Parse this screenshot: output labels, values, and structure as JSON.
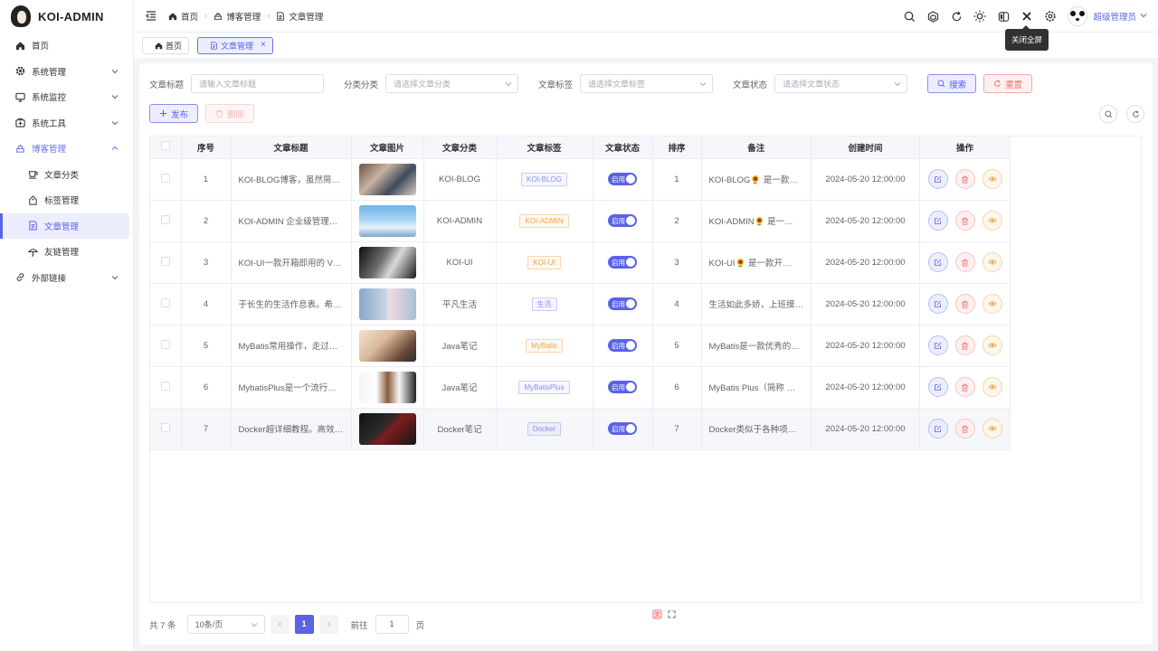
{
  "app": {
    "title": "KOI-ADMIN"
  },
  "sidebar": {
    "items": [
      {
        "label": "首页",
        "icon": "home-icon"
      },
      {
        "label": "系统管理",
        "icon": "gear-icon"
      },
      {
        "label": "系统监控",
        "icon": "monitor-icon"
      },
      {
        "label": "系统工具",
        "icon": "toolbox-icon"
      },
      {
        "label": "博客管理",
        "icon": "blog-icon"
      },
      {
        "label": "文章分类",
        "icon": "cup-icon"
      },
      {
        "label": "标签管理",
        "icon": "tag-icon"
      },
      {
        "label": "文章管理",
        "icon": "document-icon"
      },
      {
        "label": "友链管理",
        "icon": "umbrella-icon"
      },
      {
        "label": "外部链接",
        "icon": "link-icon"
      }
    ]
  },
  "header": {
    "breadcrumb": [
      "首页",
      "博客管理",
      "文章管理"
    ],
    "username": "超级管理员",
    "tooltip": "关闭全屏"
  },
  "tabs": [
    {
      "label": "首页",
      "icon": "home-icon"
    },
    {
      "label": "文章管理",
      "icon": "document-icon",
      "active": true,
      "close": "×"
    }
  ],
  "search": {
    "title_label": "文章标题",
    "title_placeholder": "请输入文章标题",
    "category_label": "分类分类",
    "category_placeholder": "请选择文章分类",
    "tag_label": "文章标签",
    "tag_placeholder": "请选择文章标签",
    "status_label": "文章状态",
    "status_placeholder": "请选择文章状态",
    "search_button": "搜索",
    "reset_button": "重置"
  },
  "actions": {
    "publish": "发布",
    "delete": "删除"
  },
  "table": {
    "columns": [
      "",
      "序号",
      "文章标题",
      "文章图片",
      "文章分类",
      "文章标签",
      "文章状态",
      "排序",
      "备注",
      "创建时间",
      "操作"
    ],
    "status_label": "启用",
    "rows": [
      {
        "index": "1",
        "title": "KOI-BLOG博客，虽然简…",
        "category": "KOI-BLOG",
        "tag": "KOI-BLOG",
        "tag_color": "#8a90ee",
        "sort": "1",
        "remark": "KOI-BLOG🌻 是一款…",
        "created": "2024-05-20 12:00:00"
      },
      {
        "index": "2",
        "title": "KOI-ADMIN 企业级管理…",
        "category": "KOI-ADMIN",
        "tag": "KOI-ADMIN",
        "tag_color": "#f0a34d",
        "sort": "2",
        "remark": "KOI-ADMIN🌻 是一…",
        "created": "2024-05-20 12:00:00"
      },
      {
        "index": "3",
        "title": "KOI-UI一款开箱即用的 V…",
        "category": "KOI-UI",
        "tag": "KOI-UI",
        "tag_color": "#f0a34d",
        "sort": "3",
        "remark": "KOI-UI🌻 是一款开…",
        "created": "2024-05-20 12:00:00"
      },
      {
        "index": "4",
        "title": "于长生的生活作息表。希…",
        "category": "平凡生活",
        "tag": "生活",
        "tag_color": "#8a90ee",
        "sort": "4",
        "remark": "生活如此多娇，上班摸…",
        "created": "2024-05-20 12:00:00"
      },
      {
        "index": "5",
        "title": "MyBatis常用操作，走过…",
        "category": "Java笔记",
        "tag": "MyBatis",
        "tag_color": "#f0a34d",
        "sort": "5",
        "remark": "MyBatis是一款优秀的…",
        "created": "2024-05-20 12:00:00"
      },
      {
        "index": "6",
        "title": "MybatisPlus是一个流行…",
        "category": "Java笔记",
        "tag": "MyBatisPlus",
        "tag_color": "#8a90ee",
        "sort": "6",
        "remark": "MyBatis Plus（简称 …",
        "created": "2024-05-20 12:00:00"
      },
      {
        "index": "7",
        "title": "Docker超详细教程。高效…",
        "category": "Docker笔记",
        "tag": "Docker",
        "tag_color": "#8a90ee",
        "sort": "7",
        "remark": "Docker类似于各种项…",
        "created": "2024-05-20 12:00:00"
      }
    ]
  },
  "pagination": {
    "total_text": "共 7 条",
    "page_size": "10条/页",
    "current_page": "1",
    "goto_label": "前往",
    "goto_value": "1",
    "goto_unit": "页"
  },
  "colors": {
    "accent": "#5a62e6",
    "danger": "#f56c6c",
    "warning": "#f0a34d"
  }
}
